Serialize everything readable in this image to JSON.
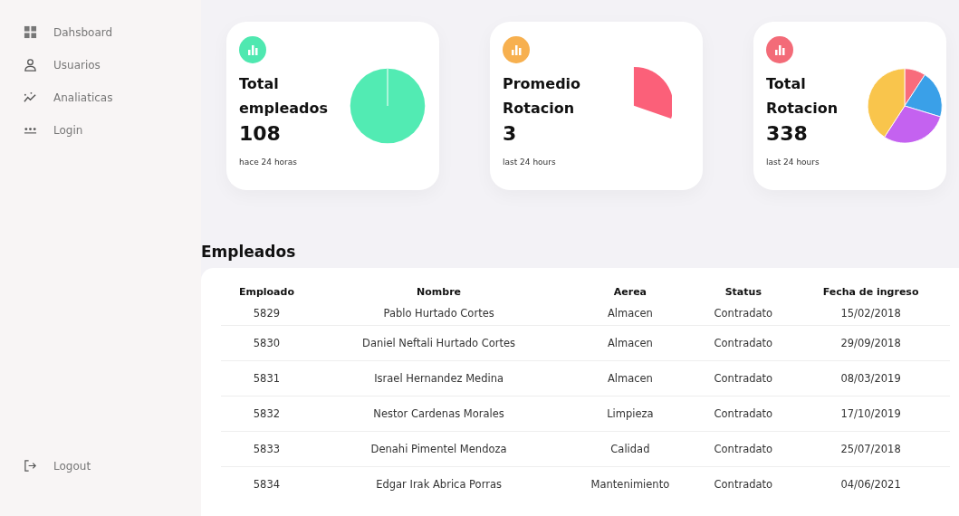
{
  "sidebar": {
    "items": [
      {
        "label": "Dahsboard",
        "kind": "grid"
      },
      {
        "label": "Usuarios",
        "kind": "user"
      },
      {
        "label": "Analiaticas",
        "kind": "trend"
      },
      {
        "label": "Login",
        "kind": "dots"
      }
    ],
    "footer": {
      "label": "Logout",
      "kind": "logout"
    }
  },
  "cards": [
    {
      "title": "Total empleados",
      "value": "108",
      "note": "hace 24 horas",
      "color": "#4fe8b0",
      "kind": "full"
    },
    {
      "title": "Promedio Rotacion",
      "value": "3",
      "note": "last 24 hours",
      "color": "#f7b04f",
      "kind": "slice"
    },
    {
      "title": "Total Rotacion",
      "value": "338",
      "note": "last 24 hours",
      "color": "#f36b78",
      "kind": "multi"
    }
  ],
  "table": {
    "title": "Empleados",
    "columns": [
      "Emploado",
      "Nombre",
      "Aerea",
      "Status",
      "Fecha de ingreso"
    ],
    "rows": [
      [
        "5829",
        "Pablo Hurtado Cortes",
        "Almacen",
        "Contradato",
        "15/02/2018"
      ],
      [
        "5830",
        "Daniel Neftali Hurtado Cortes",
        "Almacen",
        "Contradato",
        "29/09/2018"
      ],
      [
        "5831",
        "Israel Hernandez Medina",
        "Almacen",
        "Contradato",
        "08/03/2019"
      ],
      [
        "5832",
        "Nestor Cardenas Morales",
        "Limpieza",
        "Contradato",
        "17/10/2019"
      ],
      [
        "5833",
        "Denahi Pimentel Mendoza",
        "Calidad",
        "Contradato",
        "25/07/2018"
      ],
      [
        "5834",
        "Edgar Irak Abrica Porras",
        "Mantenimiento",
        "Contradato",
        "04/06/2021"
      ]
    ]
  }
}
